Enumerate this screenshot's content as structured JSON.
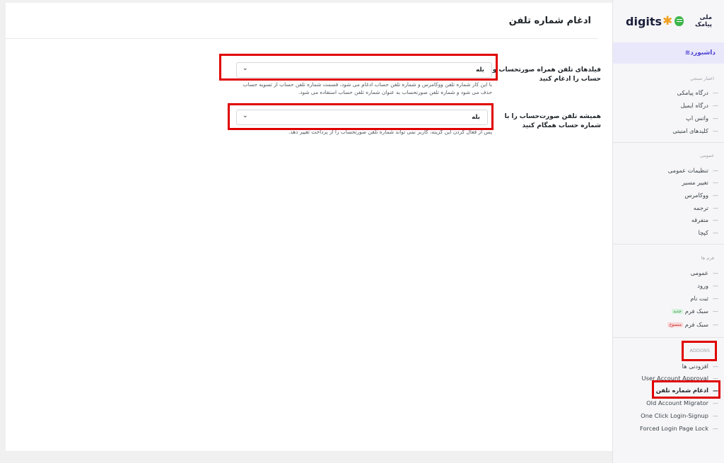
{
  "page": {
    "title": "ادغام شماره تلفن"
  },
  "settings": [
    {
      "label": "فیلدهای تلفن همراه صورتحساب و حساب را ادغام کنید",
      "value": "بله",
      "description": "با این کار شماره تلفن ووکامرس و شماره تلفن حساب ادغام می شود، قسمت شماره تلفن حساب از تسویه حساب حذف می شود و شماره تلفن صورتحساب به عنوان شماره تلفن حساب استفاده می شود."
    },
    {
      "label": "همیشه تلفن صورت‌حساب را با شماره حساب همگام کنید",
      "value": "بله",
      "description": "پس از فعال کردن این گزینه، کاربر نمی تواند شماره تلفن صورتحساب را از پرداخت تغییر دهد."
    }
  ],
  "sidebar": {
    "logo_text": "digits",
    "logo_partner": "ملی پیامک",
    "dashboard_label": "داشبورد",
    "sections": [
      {
        "heading": "اعتبار سنجی",
        "items": [
          {
            "label": "درگاه پیامکی"
          },
          {
            "label": "درگاه ایمیل"
          },
          {
            "label": "واتس اپ"
          },
          {
            "label": "کلیدهای امنیتی"
          }
        ]
      },
      {
        "heading": "عمومی",
        "items": [
          {
            "label": "تنظیمات عمومی"
          },
          {
            "label": "تغییر مسیر"
          },
          {
            "label": "ووکامرس"
          },
          {
            "label": "ترجمه"
          },
          {
            "label": "متفرقه"
          },
          {
            "label": "کپچا"
          }
        ]
      },
      {
        "heading": "فرم ها",
        "items": [
          {
            "label": "عمومی"
          },
          {
            "label": "ورود"
          },
          {
            "label": "ثبت نام"
          },
          {
            "label": "سبک فرم",
            "badge": "جدید"
          },
          {
            "label": "سبک فرم",
            "badge": "منسوخ"
          }
        ]
      },
      {
        "heading": "ADDONS",
        "items": [
          {
            "label": "افزودنی ها"
          },
          {
            "label": "User Account Approval"
          },
          {
            "label": "ادغام شماره تلفن",
            "active": true
          },
          {
            "label": "Old Account Migrator"
          },
          {
            "label": "One Click Login-Signup"
          },
          {
            "label": "Forced Login Page Lock"
          }
        ]
      }
    ]
  },
  "colors": {
    "accent": "#4b3fd1",
    "highlight_border": "#e00000",
    "badge_new_bg": "#d6f2dc",
    "badge_deprecated_bg": "#f9d8d8"
  }
}
